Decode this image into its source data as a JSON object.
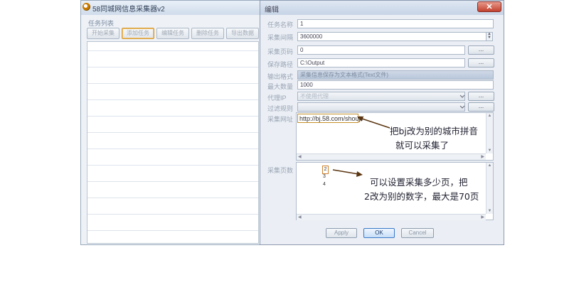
{
  "main_window": {
    "title": "58同城网信息采集器v2",
    "group_label": "任务列表",
    "toolbar_buttons": [
      "开始采集",
      "添加任务",
      "编辑任务",
      "删除任务",
      "导出数据"
    ]
  },
  "dialog": {
    "title": "编辑",
    "close_label": "✕",
    "fields": [
      {
        "label": "任务名称",
        "value": "1"
      },
      {
        "label": "采集间隔",
        "value": "3600000"
      },
      {
        "label": "采集页码",
        "value": "0"
      },
      {
        "label": "保存路径",
        "value": "C:\\Output"
      },
      {
        "label": "输出格式",
        "value": "采集信息保存为文本格式(Text文件)"
      },
      {
        "label": "最大数量",
        "value": "1000"
      },
      {
        "label": "代理IP",
        "value": "不使用代理"
      },
      {
        "label": "过滤规则",
        "value": ""
      }
    ],
    "url_label": "采集网址",
    "url_value": "http://bj.58.com/shouji/",
    "pages_label": "采集页数",
    "pages_values": [
      "2",
      "3",
      "4"
    ],
    "buttons": {
      "apply": "Apply",
      "ok": "OK",
      "cancel": "Cancel"
    },
    "browse_label": "..."
  },
  "annotations": {
    "url_note_line1": "把bj改为别的城市拼音",
    "url_note_line2": "就可以采集了",
    "pages_note_line1": "可以设置采集多少页，把",
    "pages_note_line2": "2改为别的数字，最大是70页"
  }
}
